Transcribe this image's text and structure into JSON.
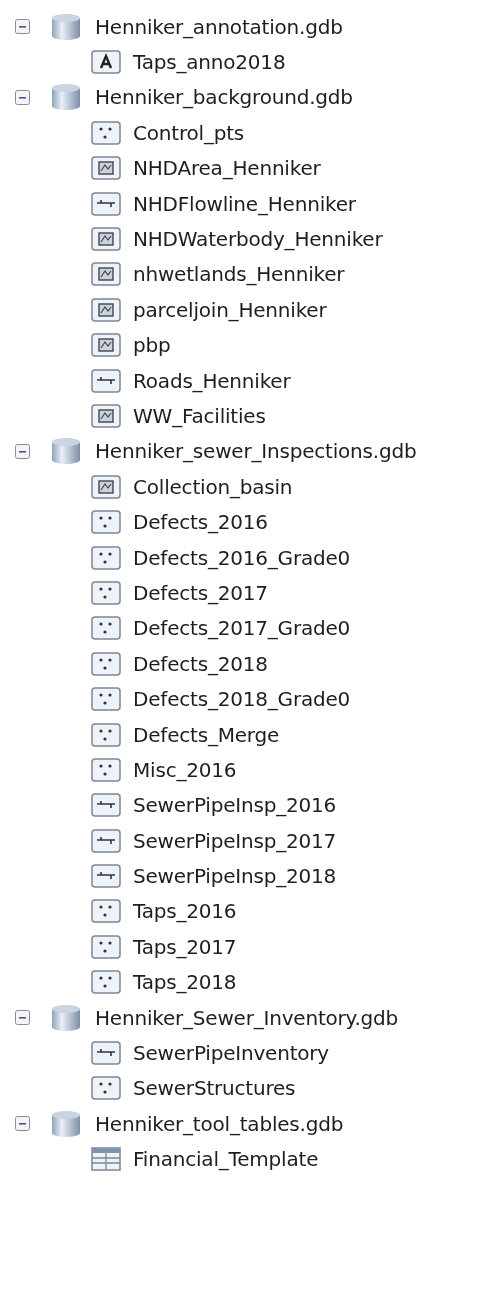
{
  "tree": [
    {
      "label": "Henniker_annotation.gdb",
      "kind": "database",
      "expanded": true,
      "children": [
        {
          "label": "Taps_anno2018",
          "kind": "annotation"
        }
      ]
    },
    {
      "label": "Henniker_background.gdb",
      "kind": "database",
      "expanded": true,
      "children": [
        {
          "label": "Control_pts",
          "kind": "point"
        },
        {
          "label": "NHDArea_Henniker",
          "kind": "polygon"
        },
        {
          "label": "NHDFlowline_Henniker",
          "kind": "line"
        },
        {
          "label": "NHDWaterbody_Henniker",
          "kind": "polygon"
        },
        {
          "label": "nhwetlands_Henniker",
          "kind": "polygon"
        },
        {
          "label": "parceljoin_Henniker",
          "kind": "polygon"
        },
        {
          "label": "pbp",
          "kind": "polygon"
        },
        {
          "label": "Roads_Henniker",
          "kind": "line"
        },
        {
          "label": "WW_Facilities",
          "kind": "polygon"
        }
      ]
    },
    {
      "label": "Henniker_sewer_Inspections.gdb",
      "kind": "database",
      "expanded": true,
      "children": [
        {
          "label": "Collection_basin",
          "kind": "polygon"
        },
        {
          "label": "Defects_2016",
          "kind": "point"
        },
        {
          "label": "Defects_2016_Grade0",
          "kind": "point"
        },
        {
          "label": "Defects_2017",
          "kind": "point"
        },
        {
          "label": "Defects_2017_Grade0",
          "kind": "point"
        },
        {
          "label": "Defects_2018",
          "kind": "point"
        },
        {
          "label": "Defects_2018_Grade0",
          "kind": "point"
        },
        {
          "label": "Defects_Merge",
          "kind": "point"
        },
        {
          "label": "Misc_2016",
          "kind": "point"
        },
        {
          "label": "SewerPipeInsp_2016",
          "kind": "line"
        },
        {
          "label": "SewerPipeInsp_2017",
          "kind": "line"
        },
        {
          "label": "SewerPipeInsp_2018",
          "kind": "line"
        },
        {
          "label": "Taps_2016",
          "kind": "point"
        },
        {
          "label": "Taps_2017",
          "kind": "point"
        },
        {
          "label": "Taps_2018",
          "kind": "point"
        }
      ]
    },
    {
      "label": "Henniker_Sewer_Inventory.gdb",
      "kind": "database",
      "expanded": true,
      "children": [
        {
          "label": "SewerPipeInventory",
          "kind": "line"
        },
        {
          "label": "SewerStructures",
          "kind": "point"
        }
      ]
    },
    {
      "label": "Henniker_tool_tables.gdb",
      "kind": "database",
      "expanded": true,
      "children": [
        {
          "label": "Financial_Template",
          "kind": "table"
        }
      ]
    }
  ]
}
